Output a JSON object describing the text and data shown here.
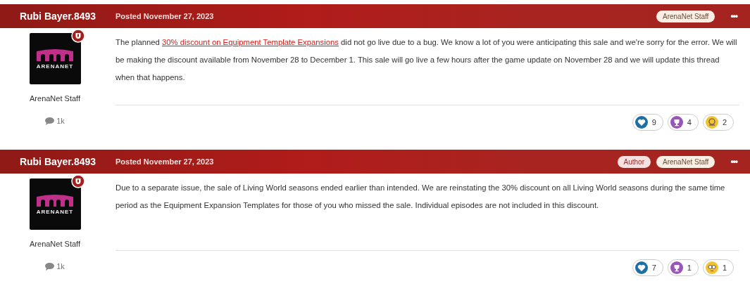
{
  "posts": [
    {
      "author": "Rubi Bayer.8493",
      "posted": "Posted November 27, 2023",
      "badges": [
        {
          "kind": "staff",
          "label": "ArenaNet Staff"
        }
      ],
      "menu": "•••",
      "avatar": {
        "label": "ARENANET"
      },
      "role": "ArenaNet Staff",
      "comments": "1k",
      "body": [
        {
          "kind": "text",
          "text": "The planned "
        },
        {
          "kind": "link",
          "text": "30% discount on Equipment Template Expansions"
        },
        {
          "kind": "text",
          "text": " did not go live due to a bug. We know a lot of you were anticipating this sale and we're sorry for the error. We will be making the discount available from November 28 to December 1. This sale will go live a few hours after the game update on November 28 and we will update this thread when that happens."
        }
      ],
      "reactions": [
        {
          "kind": "like",
          "count": "9"
        },
        {
          "kind": "thanks",
          "count": "4"
        },
        {
          "kind": "helpful",
          "count": "2"
        }
      ]
    },
    {
      "author": "Rubi Bayer.8493",
      "posted": "Posted November 27, 2023",
      "badges": [
        {
          "kind": "author",
          "label": "Author"
        },
        {
          "kind": "staff",
          "label": "ArenaNet Staff"
        }
      ],
      "menu": "•••",
      "avatar": {
        "label": "ARENANET"
      },
      "role": "ArenaNet Staff",
      "comments": "1k",
      "body": [
        {
          "kind": "text",
          "text": "Due to a separate issue, the sale of Living World seasons ended earlier than intended. We are reinstating the 30% discount on all Living World seasons during the same time period as the Equipment Expansion Templates for those of you who missed the sale. Individual episodes are not included in this discount."
        }
      ],
      "reactions": [
        {
          "kind": "like",
          "count": "7"
        },
        {
          "kind": "thanks",
          "count": "1"
        },
        {
          "kind": "confused",
          "count": "1"
        }
      ]
    }
  ]
}
